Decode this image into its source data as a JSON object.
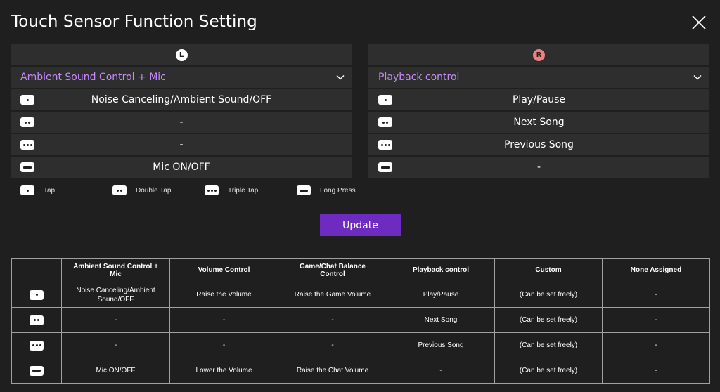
{
  "title": "Touch Sensor Function Setting",
  "colors": {
    "accent_text": "#c58af9",
    "update_button": "#6d2bc0",
    "left_badge": "#ffffff",
    "right_badge": "#f08080",
    "panel_row": "#2e2e2e",
    "background": "#1f1f1f"
  },
  "left_panel": {
    "badge": "L",
    "selected_function": "Ambient Sound Control + Mic",
    "rows": [
      {
        "gesture": "tap",
        "value": "Noise Canceling/Ambient Sound/OFF"
      },
      {
        "gesture": "double-tap",
        "value": "-"
      },
      {
        "gesture": "triple-tap",
        "value": "-"
      },
      {
        "gesture": "long-press",
        "value": "Mic ON/OFF"
      }
    ]
  },
  "right_panel": {
    "badge": "R",
    "selected_function": "Playback control",
    "rows": [
      {
        "gesture": "tap",
        "value": "Play/Pause"
      },
      {
        "gesture": "double-tap",
        "value": "Next Song"
      },
      {
        "gesture": "triple-tap",
        "value": "Previous Song"
      },
      {
        "gesture": "long-press",
        "value": "-"
      }
    ]
  },
  "legend": {
    "tap": "Tap",
    "double_tap": "Double Tap",
    "triple_tap": "Triple Tap",
    "long_press": "Long Press"
  },
  "update_label": "Update",
  "table": {
    "headers": [
      "Ambient Sound Control + Mic",
      "Volume Control",
      "Game/Chat Balance Control",
      "Playback control",
      "Custom",
      "None Assigned"
    ],
    "rows": [
      {
        "gesture": "tap",
        "cells": [
          "Noise Canceling/Ambient Sound/OFF",
          "Raise the Volume",
          "Raise the Game Volume",
          "Play/Pause",
          "(Can be set freely)",
          "-"
        ]
      },
      {
        "gesture": "double-tap",
        "cells": [
          "-",
          "-",
          "-",
          "Next Song",
          "(Can be set freely)",
          "-"
        ]
      },
      {
        "gesture": "triple-tap",
        "cells": [
          "-",
          "-",
          "-",
          "Previous Song",
          "(Can be set freely)",
          "-"
        ]
      },
      {
        "gesture": "long-press",
        "cells": [
          "Mic ON/OFF",
          "Lower the Volume",
          "Raise the Chat Volume",
          "-",
          "(Can be set freely)",
          "-"
        ]
      }
    ]
  }
}
